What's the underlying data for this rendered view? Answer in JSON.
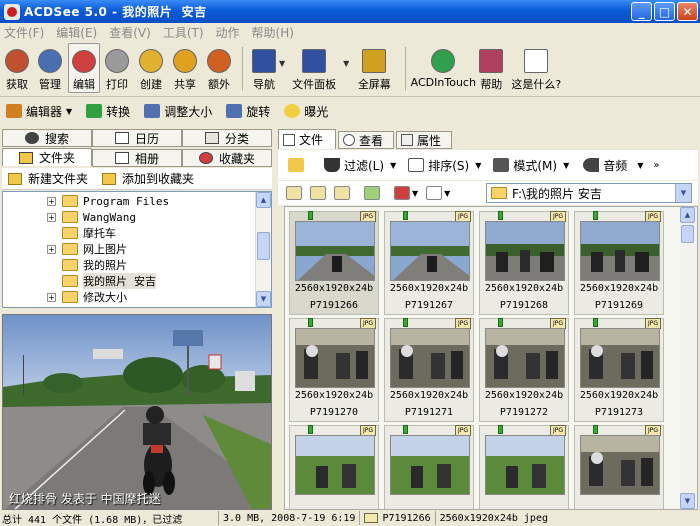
{
  "window": {
    "title": "ACDSee 5.0 - 我的照片  安吉"
  },
  "menu": [
    "文件(F)",
    "编辑(E)",
    "查看(V)",
    "工具(T)",
    "动作",
    "帮助(H)"
  ],
  "big_toolbar": [
    {
      "label": "获取",
      "icon": "acquire-icon",
      "color": "#c05030"
    },
    {
      "label": "管理",
      "icon": "manage-icon",
      "color": "#4a6fb0"
    },
    {
      "label": "编辑",
      "icon": "edit-icon",
      "color": "#d04040"
    },
    {
      "label": "打印",
      "icon": "print-icon",
      "color": "#888888"
    },
    {
      "label": "创建",
      "icon": "create-icon",
      "color": "#e0b030"
    },
    {
      "label": "共享",
      "icon": "share-icon",
      "color": "#e0a020"
    },
    {
      "label": "额外",
      "icon": "extras-icon",
      "color": "#d06020"
    },
    {
      "label": "导航",
      "icon": "navigate-icon",
      "color": "#3050a0"
    },
    {
      "label": "文件面板",
      "icon": "file-panel-icon",
      "color": "#3050a0"
    },
    {
      "label": "全屏幕",
      "icon": "fullscreen-icon",
      "color": "#d0a020"
    },
    {
      "label": "ACDInTouch",
      "icon": "acdintouch-icon",
      "color": "#30a050"
    },
    {
      "label": "帮助",
      "icon": "help-book-icon",
      "color": "#b04060"
    },
    {
      "label": "这是什么?",
      "icon": "whats-this-icon",
      "color": "#ffffff"
    }
  ],
  "edit_toolbar": [
    {
      "label": "编辑器",
      "icon": "editor-icon"
    },
    {
      "label": "转换",
      "icon": "convert-icon"
    },
    {
      "label": "调整大小",
      "icon": "resize-icon"
    },
    {
      "label": "旋转",
      "icon": "rotate-icon"
    },
    {
      "label": "曝光",
      "icon": "exposure-icon"
    }
  ],
  "left_tabs": {
    "search": "搜索",
    "calendar": "日历",
    "category": "分类",
    "folders": "文件夹",
    "album": "相册",
    "favorites": "收藏夹"
  },
  "folder_actions": {
    "new_folder": "新建文件夹",
    "add_favorite": "添加到收藏夹"
  },
  "tree": [
    {
      "label": "Program Files",
      "expand": "+",
      "mono": true
    },
    {
      "label": "WangWang",
      "expand": "+",
      "mono": true
    },
    {
      "label": "摩托车",
      "expand": "",
      "mono": false
    },
    {
      "label": "网上图片",
      "expand": "+",
      "mono": false
    },
    {
      "label": "我的照片",
      "expand": "",
      "mono": false
    },
    {
      "label": "我的照片  安吉",
      "expand": "",
      "mono": false,
      "selected": true
    },
    {
      "label": "修改大小",
      "expand": "+",
      "mono": false
    }
  ],
  "preview": {
    "watermark": "红烧排骨  发表于  中国摩托迷"
  },
  "right_tabs": {
    "files": "文件",
    "view": "查看",
    "properties": "属性"
  },
  "browser_toolbar": {
    "filter": "过滤(L)",
    "sort": "排序(S)",
    "mode": "模式(M)",
    "audio": "音频"
  },
  "path": "F:\\我的照片  安吉",
  "thumbnails": [
    {
      "res": "2560x1920x24b",
      "name": "P7191266",
      "scene": "road"
    },
    {
      "res": "2560x1920x24b",
      "name": "P7191267",
      "scene": "road"
    },
    {
      "res": "2560x1920x24b",
      "name": "P7191268",
      "scene": "group"
    },
    {
      "res": "2560x1920x24b",
      "name": "P7191269",
      "scene": "group"
    },
    {
      "res": "2560x1920x24b",
      "name": "P7191270",
      "scene": "shed"
    },
    {
      "res": "2560x1920x24b",
      "name": "P7191271",
      "scene": "shed"
    },
    {
      "res": "2560x1920x24b",
      "name": "P7191272",
      "scene": "shed"
    },
    {
      "res": "2560x1920x24b",
      "name": "P7191273",
      "scene": "shed"
    },
    {
      "res": "",
      "name": "",
      "scene": "field"
    },
    {
      "res": "",
      "name": "",
      "scene": "field"
    },
    {
      "res": "",
      "name": "",
      "scene": "field"
    },
    {
      "res": "",
      "name": "",
      "scene": "shed"
    }
  ],
  "status": {
    "left": "总计 441 个文件 (1.68 MB)，已过滤",
    "size": "3.0 MB, 2008-7-19 6:19",
    "file": "P7191266",
    "format": "2560x1920x24b jpeg"
  }
}
